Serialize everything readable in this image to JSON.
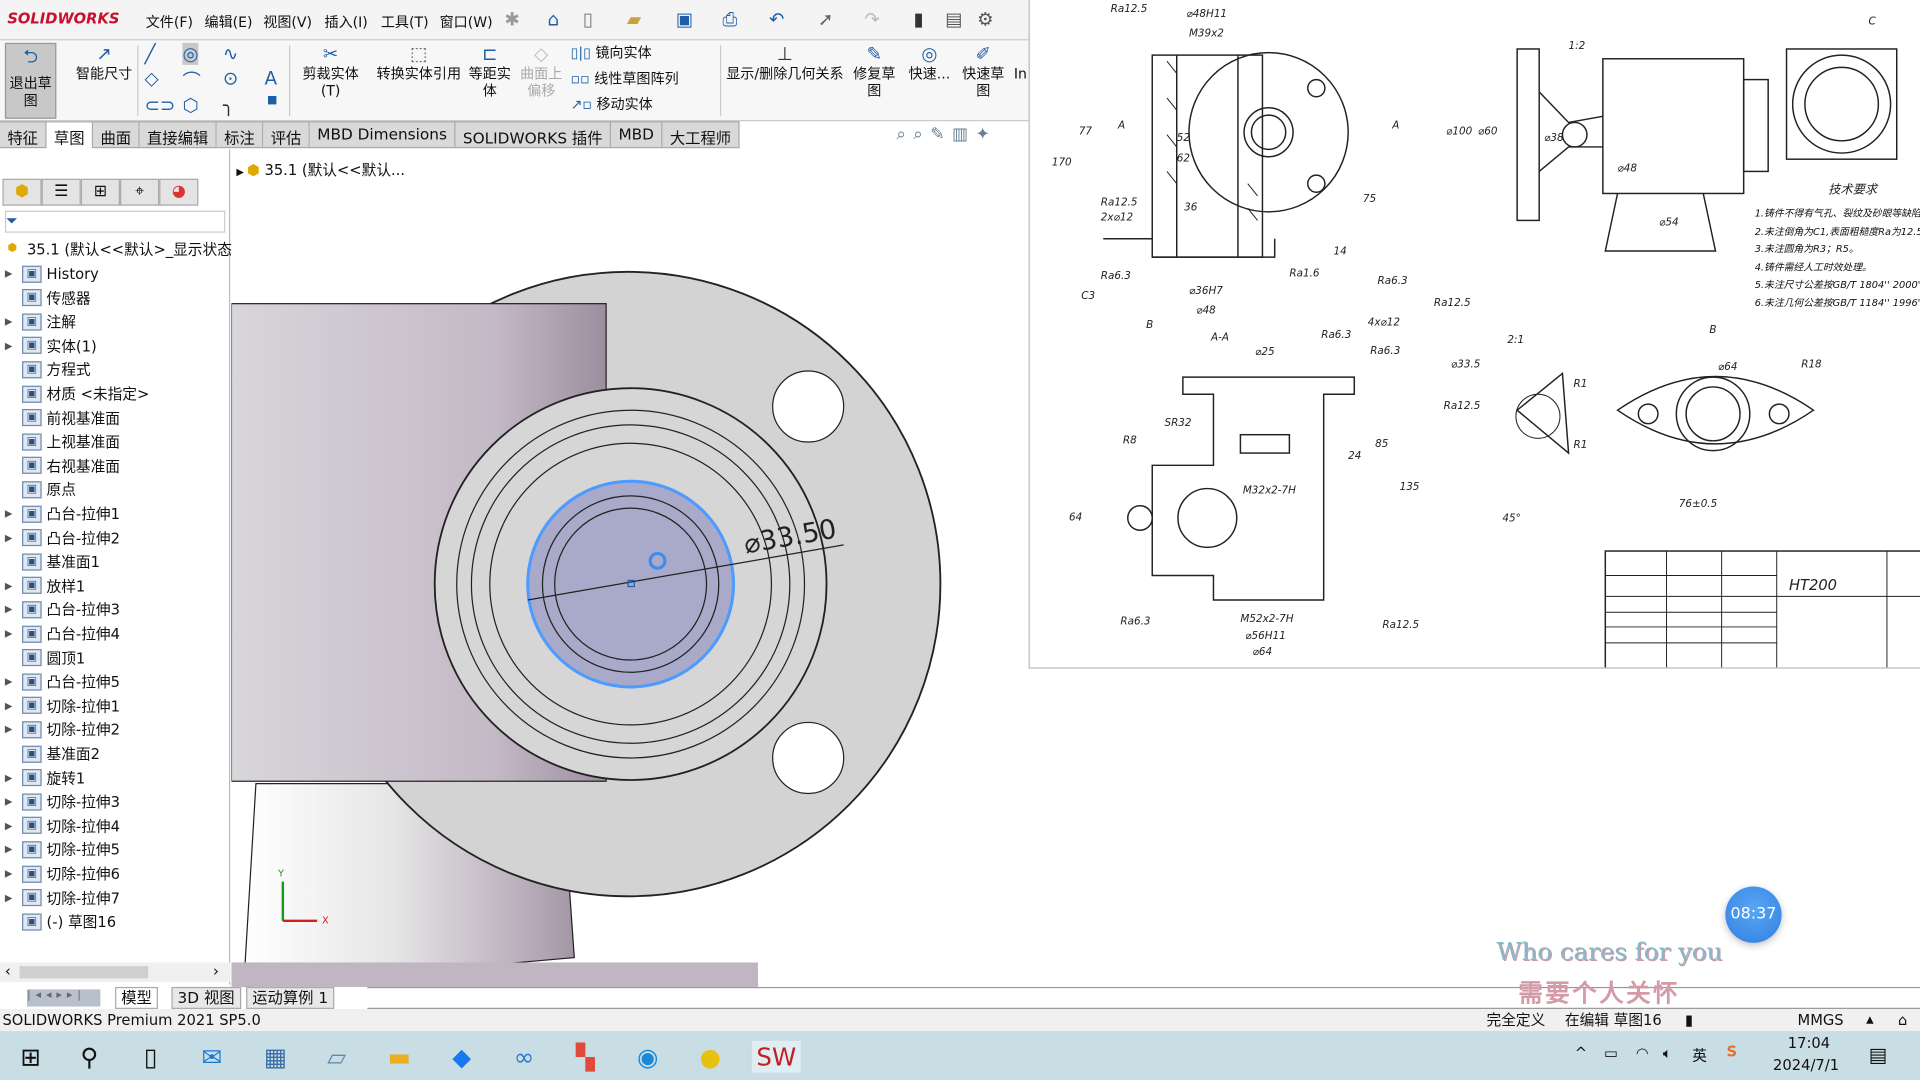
{
  "app": {
    "logo": "SOLIDWORKS",
    "version": "SOLIDWORKS Premium 2021 SP5.0"
  },
  "menu": [
    "文件(F)",
    "编辑(E)",
    "视图(V)",
    "插入(I)",
    "工具(T)",
    "窗口(W)"
  ],
  "ribbon": {
    "exit_sketch": "退出草图",
    "smart_dim": "智能尺寸",
    "trim": "剪裁实体(T)",
    "convert": "转换实体引用",
    "offset": "等距实体",
    "offset_surface": "曲面上偏移",
    "mirror": "镜向实体",
    "linear_pattern": "线性草图阵列",
    "move": "移动实体",
    "relations": "显示/删除几何关系",
    "repair": "修复草图",
    "quick1": "快速...",
    "quick2": "快速草图",
    "more": "In"
  },
  "command_tabs": [
    "特征",
    "草图",
    "曲面",
    "直接编辑",
    "标注",
    "评估",
    "MBD Dimensions",
    "SOLIDWORKS 插件",
    "MBD",
    "大工程师"
  ],
  "active_tab": "草图",
  "tree": {
    "root": "35.1 (默认<<默认>_显示状态",
    "items": [
      {
        "label": "History",
        "exp": true
      },
      {
        "label": "传感器",
        "exp": false
      },
      {
        "label": "注解",
        "exp": true
      },
      {
        "label": "实体(1)",
        "exp": true
      },
      {
        "label": "方程式",
        "exp": false
      },
      {
        "label": "材质 <未指定>",
        "exp": false
      },
      {
        "label": "前视基准面",
        "exp": false
      },
      {
        "label": "上视基准面",
        "exp": false
      },
      {
        "label": "右视基准面",
        "exp": false
      },
      {
        "label": "原点",
        "exp": false
      },
      {
        "label": "凸台-拉伸1",
        "exp": true
      },
      {
        "label": "凸台-拉伸2",
        "exp": true
      },
      {
        "label": "基准面1",
        "exp": false
      },
      {
        "label": "放样1",
        "exp": true
      },
      {
        "label": "凸台-拉伸3",
        "exp": true
      },
      {
        "label": "凸台-拉伸4",
        "exp": true
      },
      {
        "label": "圆顶1",
        "exp": false
      },
      {
        "label": "凸台-拉伸5",
        "exp": true
      },
      {
        "label": "切除-拉伸1",
        "exp": true
      },
      {
        "label": "切除-拉伸2",
        "exp": true
      },
      {
        "label": "基准面2",
        "exp": false
      },
      {
        "label": "旋转1",
        "exp": true
      },
      {
        "label": "切除-拉伸3",
        "exp": true
      },
      {
        "label": "切除-拉伸4",
        "exp": true
      },
      {
        "label": "切除-拉伸5",
        "exp": true
      },
      {
        "label": "切除-拉伸6",
        "exp": true
      },
      {
        "label": "切除-拉伸7",
        "exp": true
      },
      {
        "label": "(-) 草图16",
        "exp": false
      }
    ]
  },
  "viewport": {
    "breadcrumb": "35.1 (默认<<默认...",
    "dimension": "⌀33.50",
    "axis_x": "X",
    "axis_y": "Y"
  },
  "bottom_tabs": [
    "模型",
    "3D 视图",
    "运动算例 1"
  ],
  "status": {
    "defined": "完全定义",
    "editing": "在编辑 草图16",
    "units": "MMGS"
  },
  "taskbar": {
    "time": "17:04",
    "date": "2024/7/1",
    "ime": "英"
  },
  "overlay": {
    "timer": "08:37",
    "watermark_en": "Who cares for you",
    "watermark_cn": "需要个人关怀"
  },
  "drawing": {
    "tech_title": "技术要求",
    "tech_notes": [
      "1.铸件不得有气孔、裂纹及砂眼等缺陷。",
      "2.未注倒角为C1,表面粗糙度Ra为12.5μm。",
      "3.未注圆角为R3；R5。",
      "4.铸件需经人工时效处理。",
      "5.未注尺寸公差按GB/T 1804'' 2000''",
      "6.未注几何公差按GB/T 1184'' 1996''"
    ],
    "material": "HT200",
    "labels": [
      "Ra12.5",
      "⌀48H11",
      "M39x2",
      "A",
      "A",
      "77",
      "170",
      "52",
      "62",
      "36",
      "75",
      "Ra12.5",
      "2x⌀12",
      "Ra6.3",
      "C3",
      "⌀36H7",
      "⌀48",
      "Ra1.6",
      "14",
      "Ra6.3",
      "Ra12.5",
      "1:2",
      "⌀100",
      "⌀60",
      "⌀38",
      "⌀48",
      "⌀54",
      "C",
      "B",
      "A-A",
      "⌀25",
      "Ra6.3",
      "4x⌀12",
      "Ra6.3",
      "SR32",
      "R8",
      "M32x2-7H",
      "85",
      "135",
      "24",
      "64",
      "M52x2-7H",
      "⌀56H11",
      "⌀64",
      "Ra6.3",
      "Ra12.5",
      "2:1",
      "⌀33.5",
      "Ra12.5",
      "R1",
      "R1",
      "45°",
      "B",
      "⌀64",
      "R18",
      "76±0.5"
    ]
  },
  "colors": {
    "accent": "#1e5fa8",
    "selection": "#5b9bef",
    "part": "#d4d4d4"
  }
}
